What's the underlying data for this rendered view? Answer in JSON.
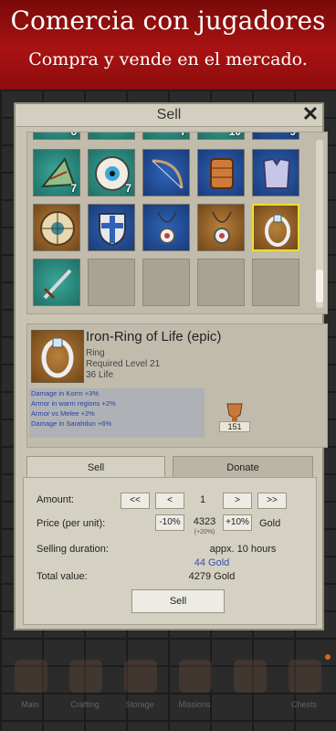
{
  "banner": {
    "title": "Comercia con jugadores",
    "subtitle": "Compra y vende en el mercado."
  },
  "dialog": {
    "title": "Sell",
    "close_icon": "close-icon"
  },
  "inventory": {
    "top_row_counts": [
      "6",
      "",
      "7",
      "10",
      "9"
    ],
    "row1": [
      {
        "icon": "scroll-map-icon",
        "count": "7",
        "bg": "teal"
      },
      {
        "icon": "eye-charm-icon",
        "count": "7",
        "bg": "teal"
      },
      {
        "icon": "bow-icon",
        "count": "",
        "bg": "blue"
      },
      {
        "icon": "leather-armor-icon",
        "count": "",
        "bg": "blue"
      },
      {
        "icon": "chest-armor-icon",
        "count": "",
        "bg": "blue"
      }
    ],
    "row2": [
      {
        "icon": "round-shield-icon",
        "bg": "brown"
      },
      {
        "icon": "cross-shield-icon",
        "bg": "blue"
      },
      {
        "icon": "amulet-icon",
        "bg": "blue"
      },
      {
        "icon": "amulet-icon",
        "bg": "brown"
      },
      {
        "icon": "ring-icon",
        "bg": "brown",
        "selected": true
      }
    ],
    "row3": [
      {
        "icon": "sword-icon",
        "bg": "teal"
      }
    ]
  },
  "item": {
    "name": "Iron-Ring of Life (epic)",
    "type": "Ring",
    "required_level": "Required Level 21",
    "stat": "36 Life",
    "bonuses": [
      "Damage in Korrn +3%",
      "Armor in warm regions +2%",
      "Armor vs Melee +2%",
      "Damage in Sarahdun +6%"
    ],
    "trophy_value": "151"
  },
  "tabs": {
    "sell": "Sell",
    "donate": "Donate"
  },
  "form": {
    "amount_label": "Amount:",
    "btn_first": "<<",
    "btn_prev": "<",
    "amount_value": "1",
    "btn_next": ">",
    "btn_last": ">>",
    "price_label": "Price (per unit):",
    "btn_minus": "-10%",
    "price_value": "4323",
    "price_pct": "(+20%)",
    "btn_plus": "+10%",
    "currency": "Gold",
    "duration_label": "Selling duration:",
    "duration_value": "appx. 10 hours",
    "fee": "44 Gold",
    "total_label": "Total value:",
    "total_value": "4279 Gold",
    "sell_button": "Sell"
  },
  "nav": [
    {
      "label": "Main",
      "icon": "house-icon"
    },
    {
      "label": "Crafting",
      "icon": "anvil-icon"
    },
    {
      "label": "Storage",
      "icon": "bag-icon"
    },
    {
      "label": "Missions",
      "icon": "scroll-icon"
    },
    {
      "label": "",
      "icon": "blank-icon"
    },
    {
      "label": "Chests",
      "icon": "chest-icon"
    }
  ]
}
